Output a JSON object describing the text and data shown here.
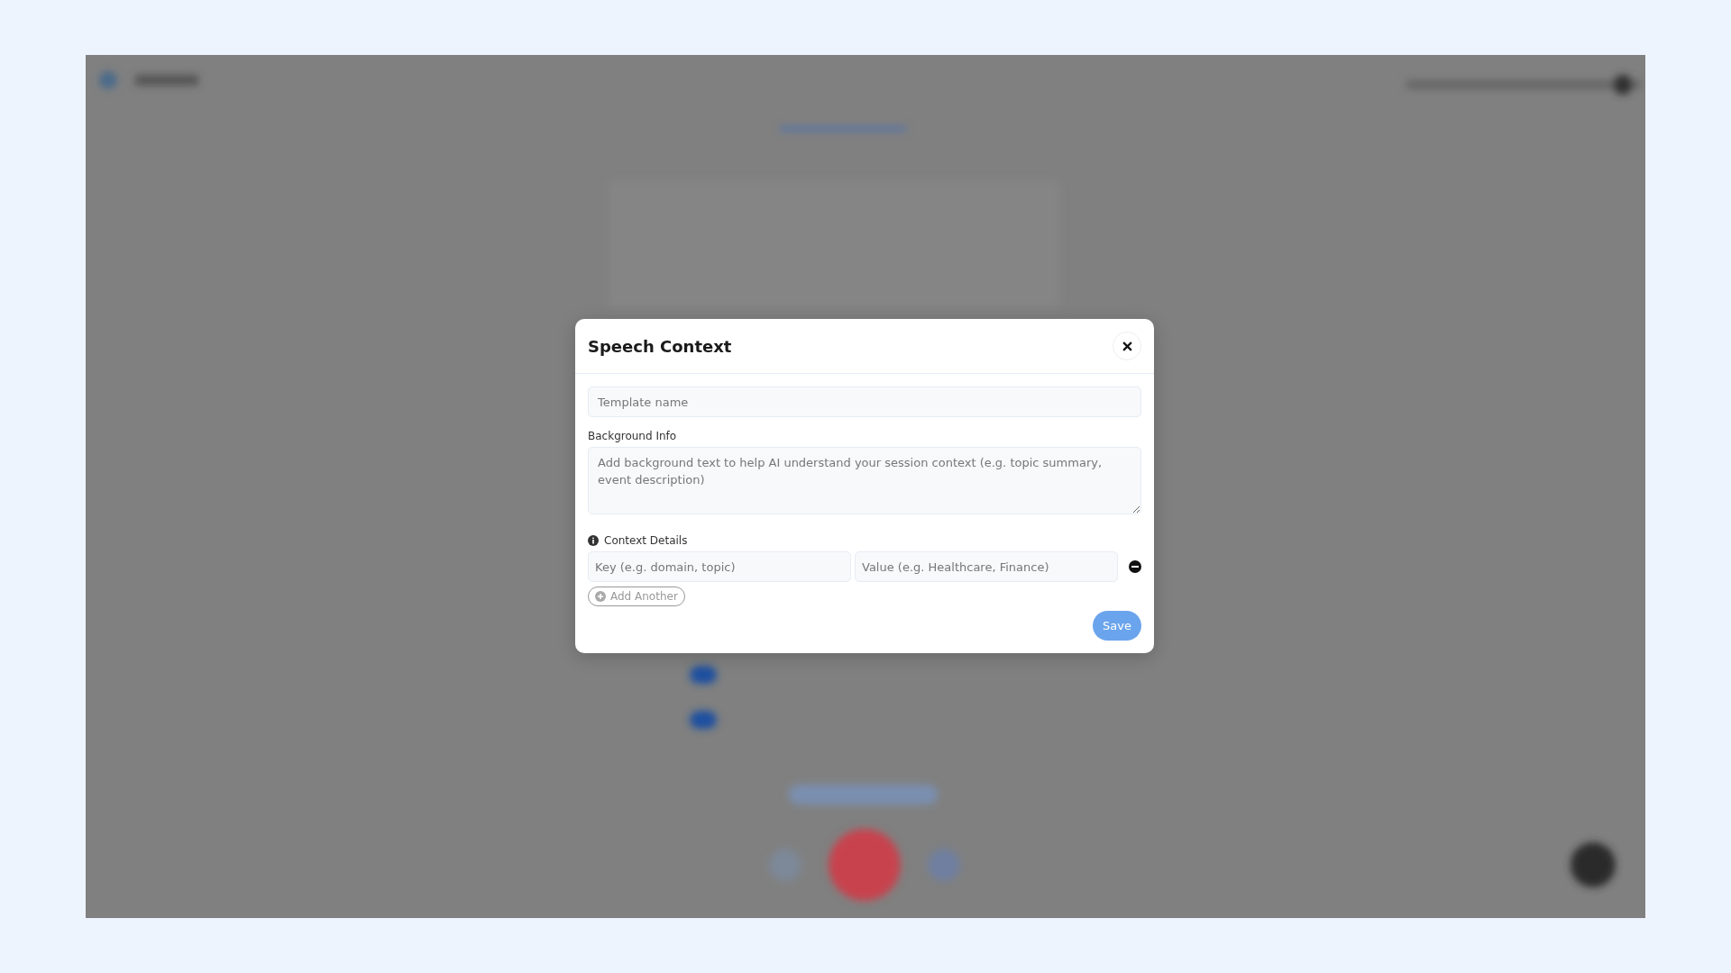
{
  "dialog": {
    "title": "Speech Context",
    "template_name": {
      "placeholder": "Template name"
    },
    "background_info": {
      "label": "Background Info",
      "placeholder": "Add background text to help AI understand your session context (e.g. topic summary, event description)"
    },
    "context_details": {
      "label": "Context Details",
      "rows": [
        {
          "key_placeholder": "Key (e.g. domain, topic)",
          "value_placeholder": "Value (e.g. Healthcare, Finance)"
        }
      ],
      "add_button": "Add Another"
    },
    "save_button": "Save"
  }
}
